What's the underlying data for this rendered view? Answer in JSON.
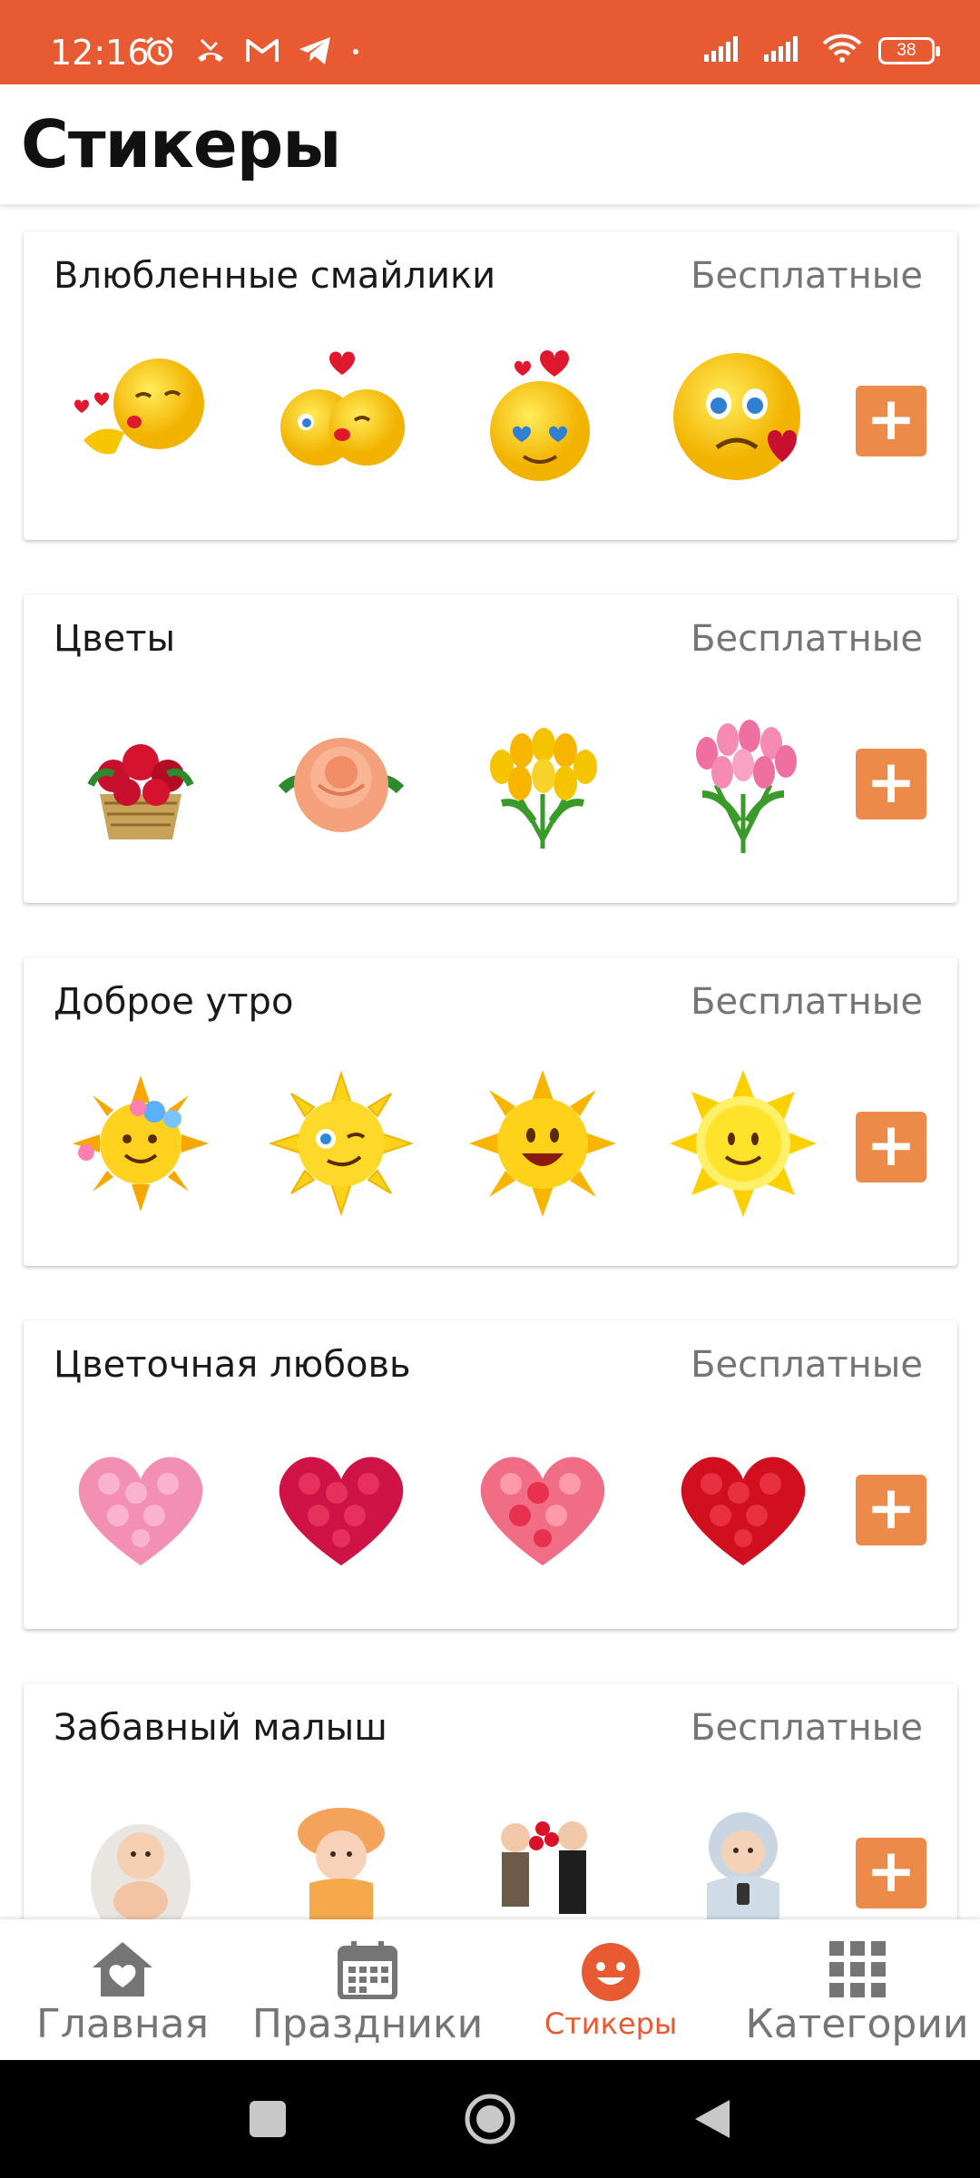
{
  "status_bar": {
    "time": "12:16",
    "battery": "38",
    "left_icons": [
      "alarm-icon",
      "missed-call-icon",
      "gmail-icon",
      "telegram-icon",
      "dot-icon"
    ],
    "right_icons": [
      "signal-icon",
      "signal-icon",
      "wifi-icon",
      "battery-icon"
    ],
    "color": "#e85b32"
  },
  "app_bar": {
    "title": "Стикеры"
  },
  "packs": [
    {
      "title": "Влюбленные смайлики",
      "price": "Бесплатные",
      "stickers": [
        "kiss-emoji-sticker",
        "kissing-couple-emoji-sticker",
        "love-eyes-emoji-sticker",
        "heartbroken-emoji-sticker"
      ]
    },
    {
      "title": "Цветы",
      "price": "Бесплатные",
      "stickers": [
        "rose-basket-sticker",
        "peach-rose-sticker",
        "yellow-tulips-sticker",
        "pink-tulips-sticker"
      ]
    },
    {
      "title": "Доброе утро",
      "price": "Бесплатные",
      "stickers": [
        "flower-sun-sticker",
        "winking-sun-sticker",
        "smiling-sun-sticker",
        "happy-sun-sticker"
      ]
    },
    {
      "title": "Цветочная любовь",
      "price": "Бесплатные",
      "stickers": [
        "pink-roses-heart-sticker",
        "crimson-roses-heart-sticker",
        "mixed-roses-heart-sticker",
        "red-roses-heart-sticker"
      ]
    },
    {
      "title": "Забавный малыш",
      "price": "Бесплатные",
      "stickers": [
        "baby-egg-sticker",
        "girl-hat-sticker",
        "kids-flowers-sticker",
        "baby-phone-sticker"
      ]
    }
  ],
  "add_button_label": "+",
  "bottom_nav": {
    "items": [
      {
        "label": "Главная",
        "icon": "home-heart-icon",
        "active": false
      },
      {
        "label": "Праздники",
        "icon": "calendar-icon",
        "active": false
      },
      {
        "label": "Стикеры",
        "icon": "smiley-icon",
        "active": true
      },
      {
        "label": "Категории",
        "icon": "grid-icon",
        "active": false
      }
    ],
    "active_color": "#e85b32"
  },
  "system_nav": [
    "recents-button",
    "home-button",
    "back-button"
  ]
}
